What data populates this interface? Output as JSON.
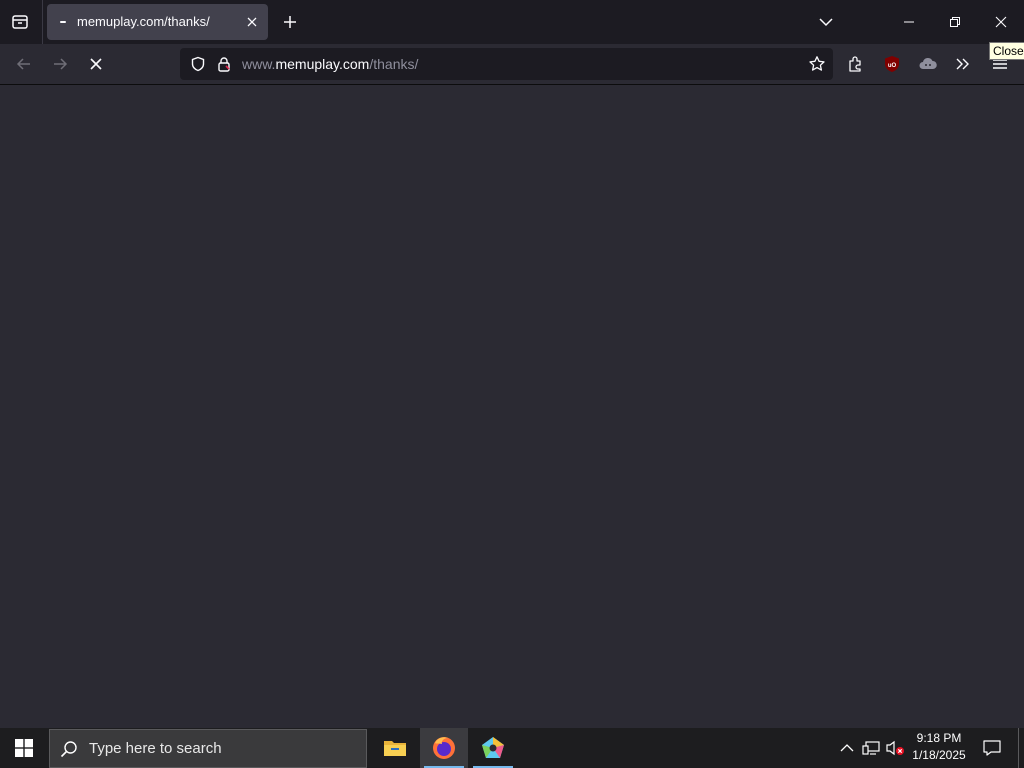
{
  "browser": {
    "tab": {
      "title": "memuplay.com/thanks/"
    },
    "url": {
      "prefix": "www.",
      "host": "memuplay.com",
      "path": "/thanks/"
    },
    "tooltip": "Close",
    "colors": {
      "titlebar": "#1c1b22",
      "toolbar": "#2b2a33",
      "content": "#2b2a33",
      "tab_active": "#42414d",
      "urlbar": "#1c1b22"
    }
  },
  "taskbar": {
    "search_placeholder": "Type here to search",
    "apps": [
      "file-explorer-icon",
      "firefox-icon",
      "app-pentagon-icon"
    ],
    "clock": {
      "time": "9:18 PM",
      "date": "1/18/2025"
    }
  }
}
